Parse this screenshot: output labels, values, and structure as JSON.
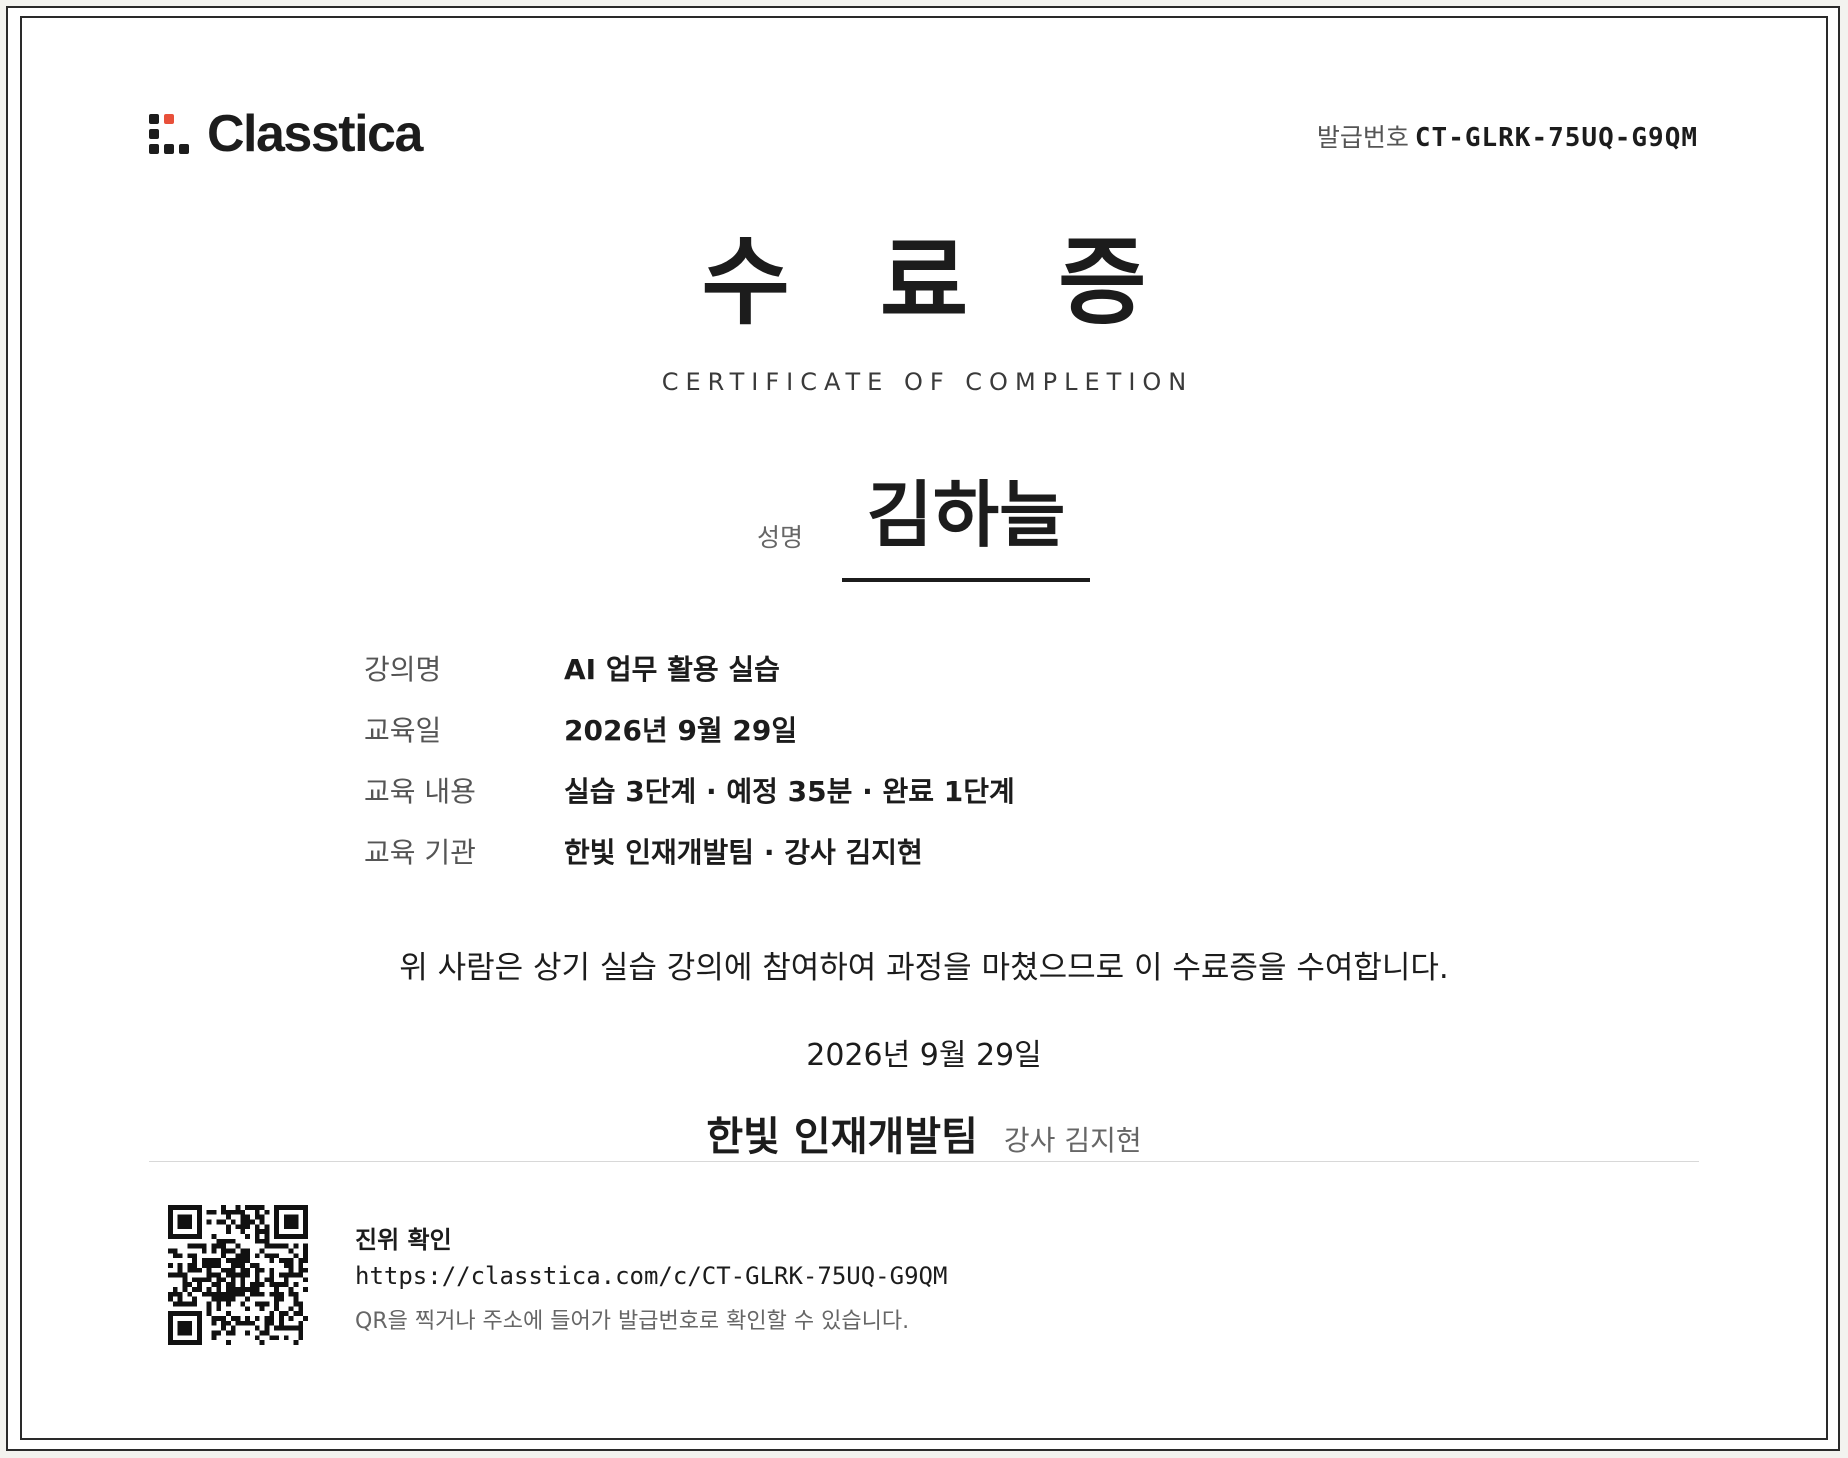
{
  "brand": {
    "name": "Classtica",
    "accent_color": "#e8503a"
  },
  "issue": {
    "label": "발급번호",
    "code": "CT-GLRK-75UQ-G9QM"
  },
  "title": "수료증",
  "subtitle": "CERTIFICATE OF COMPLETION",
  "recipient": {
    "label": "성명",
    "name": "김하늘"
  },
  "details": [
    {
      "label": "강의명",
      "value": "AI 업무 활용 실습"
    },
    {
      "label": "교육일",
      "value": "2026년 9월 29일"
    },
    {
      "label": "교육 내용",
      "value": "실습 3단계 · 예정 35분 · 완료 1단계"
    },
    {
      "label": "교육 기관",
      "value": "한빛 인재개발팀 · 강사 김지현"
    }
  ],
  "statement": "위 사람은 상기 실습 강의에 참여하여 과정을 마쳤으므로 이 수료증을 수여합니다.",
  "issue_date": "2026년 9월 29일",
  "issuer": {
    "name": "한빛 인재개발팀",
    "instructor": "강사 김지현"
  },
  "verification": {
    "title": "진위 확인",
    "url": "https://classtica.com/c/CT-GLRK-75UQ-G9QM",
    "note": "QR을 찍거나 주소에 들어가 발급번호로 확인할 수 있습니다."
  }
}
